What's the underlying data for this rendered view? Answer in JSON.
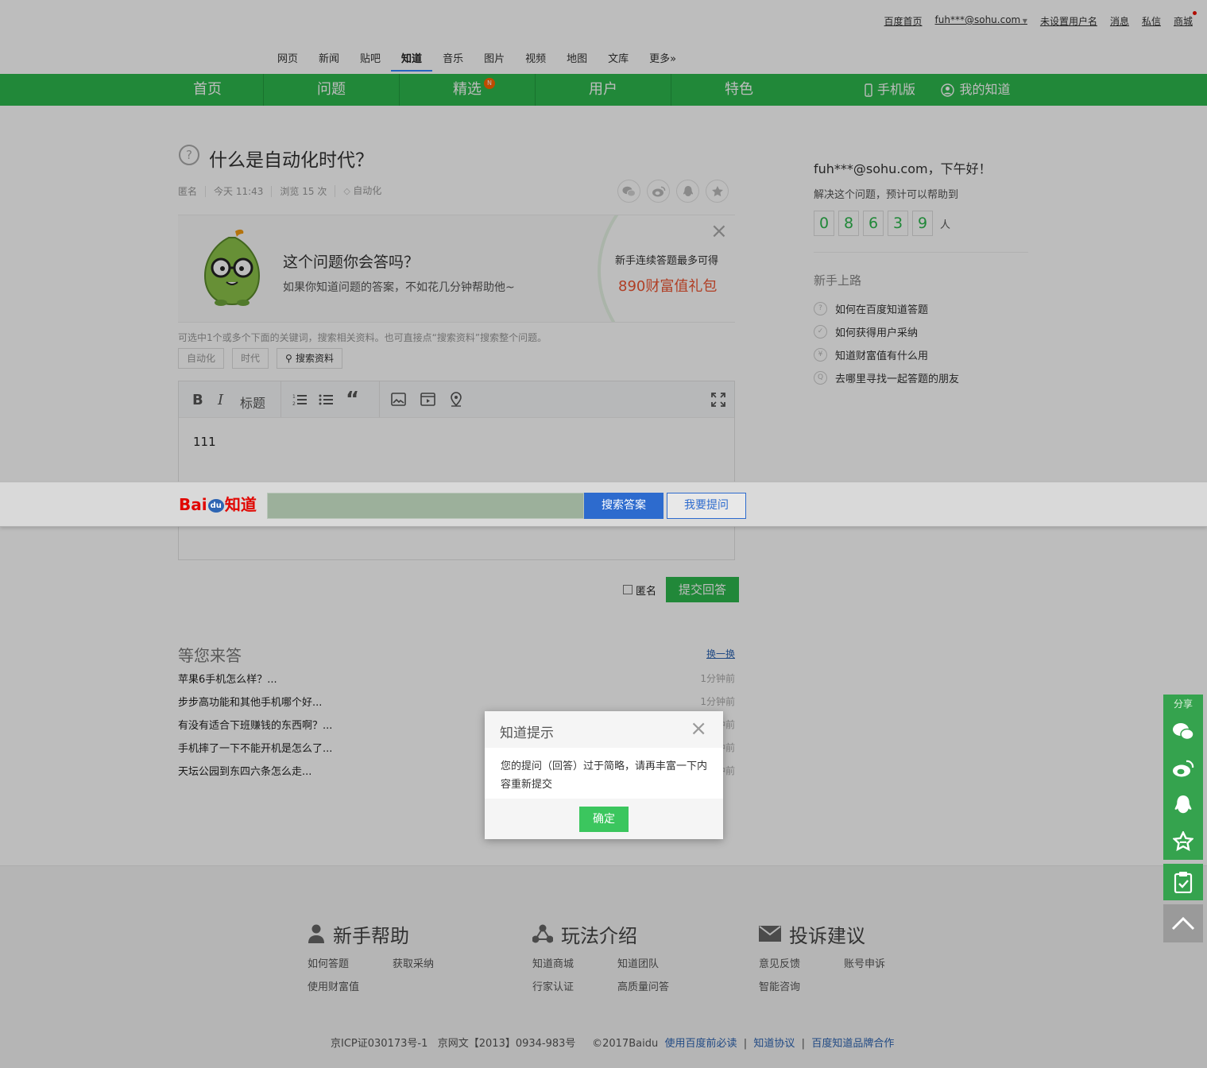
{
  "userbar": {
    "home": "百度首页",
    "account": "fuh***@sohu.com",
    "username": "未设置用户名",
    "messages": "消息",
    "private_msg": "私信",
    "mall": "商城"
  },
  "product_nav": [
    "网页",
    "新闻",
    "贴吧",
    "知道",
    "音乐",
    "图片",
    "视频",
    "地图",
    "文库",
    "更多»"
  ],
  "product_nav_active": "知道",
  "green_nav": {
    "home": "首页",
    "questions": "问题",
    "featured": "精选",
    "featured_badge": "N",
    "users": "用户",
    "special": "特色",
    "mobile": "手机版",
    "my_zhidao": "我的知道"
  },
  "question": {
    "title": "什么是自动化时代？",
    "author": "匿名",
    "time": "今天 11:43",
    "views": "浏览 15 次",
    "tag": "自动化"
  },
  "promo": {
    "heading": "这个问题你会答吗？",
    "sub": "如果你知道问题的答案，不如花几分钟帮助他~",
    "right1": "新手连续答题最多可得",
    "right2": "890财富值礼包"
  },
  "keywords": {
    "hint": "可选中1个或多个下面的关键词，搜索相关资料。也可直接点“搜索资料”搜索整个问题。",
    "items": [
      "自动化",
      "时代"
    ],
    "search": "搜索资料"
  },
  "editor": {
    "bold": "B",
    "italic": "I",
    "heading": "标题",
    "content": "111"
  },
  "sidebar": {
    "greeting": "fuh***@sohu.com，下午好！",
    "sub": "解决这个问题，预计可以帮助到",
    "digits": [
      "0",
      "8",
      "6",
      "3",
      "9"
    ],
    "unit": "人",
    "guide_title": "新手上路",
    "guide_items": [
      "如何在百度知道答题",
      "如何获得用户采纳",
      "知道财富值有什么用",
      "去哪里寻找一起答题的朋友"
    ]
  },
  "sticky": {
    "logo_bai": "Bai",
    "logo_du": "du",
    "logo_zd": "知道",
    "search_btn": "搜索答案",
    "ask_btn": "我要提问"
  },
  "submit": {
    "anonymous": "匿名",
    "button": "提交回答"
  },
  "waiting": {
    "title": "等您来答",
    "swap": "换一换",
    "items": [
      {
        "q": "苹果6手机怎么样？...",
        "t": "1分钟前"
      },
      {
        "q": "步步高功能和其他手机哪个好...",
        "t": "1分钟前"
      },
      {
        "q": "有没有适合下班赚钱的东西啊？...",
        "t": "1分钟前"
      },
      {
        "q": "手机摔了一下不能开机是怎么了...",
        "t": "1分钟前"
      },
      {
        "q": "天坛公园到东四六条怎么走...",
        "t": "1分钟前"
      }
    ]
  },
  "footer": {
    "help": {
      "title": "新手帮助",
      "links": [
        "如何答题",
        "获取采纳",
        "使用财富值"
      ]
    },
    "play": {
      "title": "玩法介绍",
      "links": [
        "知道商城",
        "知道团队",
        "行家认证",
        "高质量问答"
      ]
    },
    "complaint": {
      "title": "投诉建议",
      "links": [
        "意见反馈",
        "账号申诉",
        "智能咨询"
      ]
    },
    "icp": "京ICP证030173号-1",
    "wenwang": "京网文【2013】0934-983号",
    "copyright": "©2017Baidu",
    "link1": "使用百度前必读",
    "link2": "知道协议",
    "link3": "百度知道品牌合作",
    "sep": "|"
  },
  "share_panel": {
    "title": "分享"
  },
  "modal": {
    "title": "知道提示",
    "body": "您的提问（回答）过于简略，请再丰富一下内容重新提交",
    "ok": "确定"
  }
}
